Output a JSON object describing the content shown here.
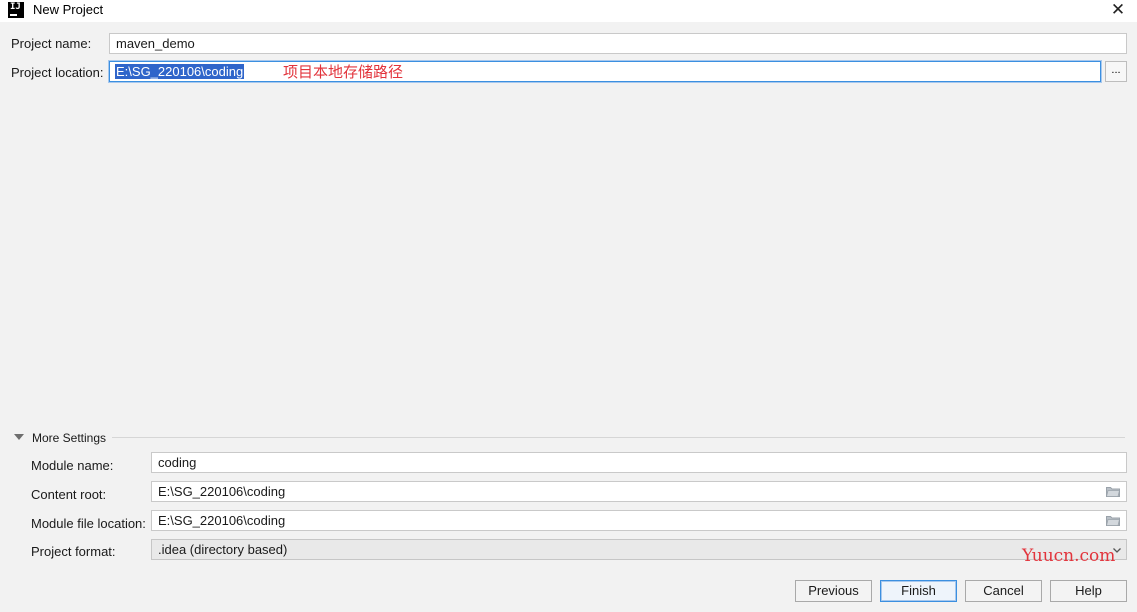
{
  "window": {
    "title": "New Project",
    "app_icon_text": "IJ",
    "close_glyph": "✕"
  },
  "project": {
    "name_label": "Project name:",
    "name_value": "maven_demo",
    "location_label": "Project location:",
    "location_value": "E:\\SG_220106\\coding",
    "browse_label": "...",
    "annotation": "项目本地存储路径"
  },
  "more_settings": {
    "label": "More Settings",
    "expanded": true,
    "module_name_label": "Module name:",
    "module_name_value": "coding",
    "content_root_label": "Content root:",
    "content_root_value": "E:\\SG_220106\\coding",
    "module_file_label": "Module file location:",
    "module_file_value": "E:\\SG_220106\\coding",
    "project_format_label": "Project format:",
    "project_format_value": ".idea (directory based)"
  },
  "buttons": {
    "previous": "Previous",
    "finish": "Finish",
    "cancel": "Cancel",
    "help": "Help"
  },
  "watermark": "Yuucn.com",
  "colors": {
    "accent": "#3b8fe0",
    "selection": "#2f65ca",
    "annotation": "#e2343c"
  },
  "icons": [
    "close-icon",
    "ellipsis-icon",
    "triangle-down-icon",
    "folder-icon",
    "chevron-down-icon"
  ]
}
